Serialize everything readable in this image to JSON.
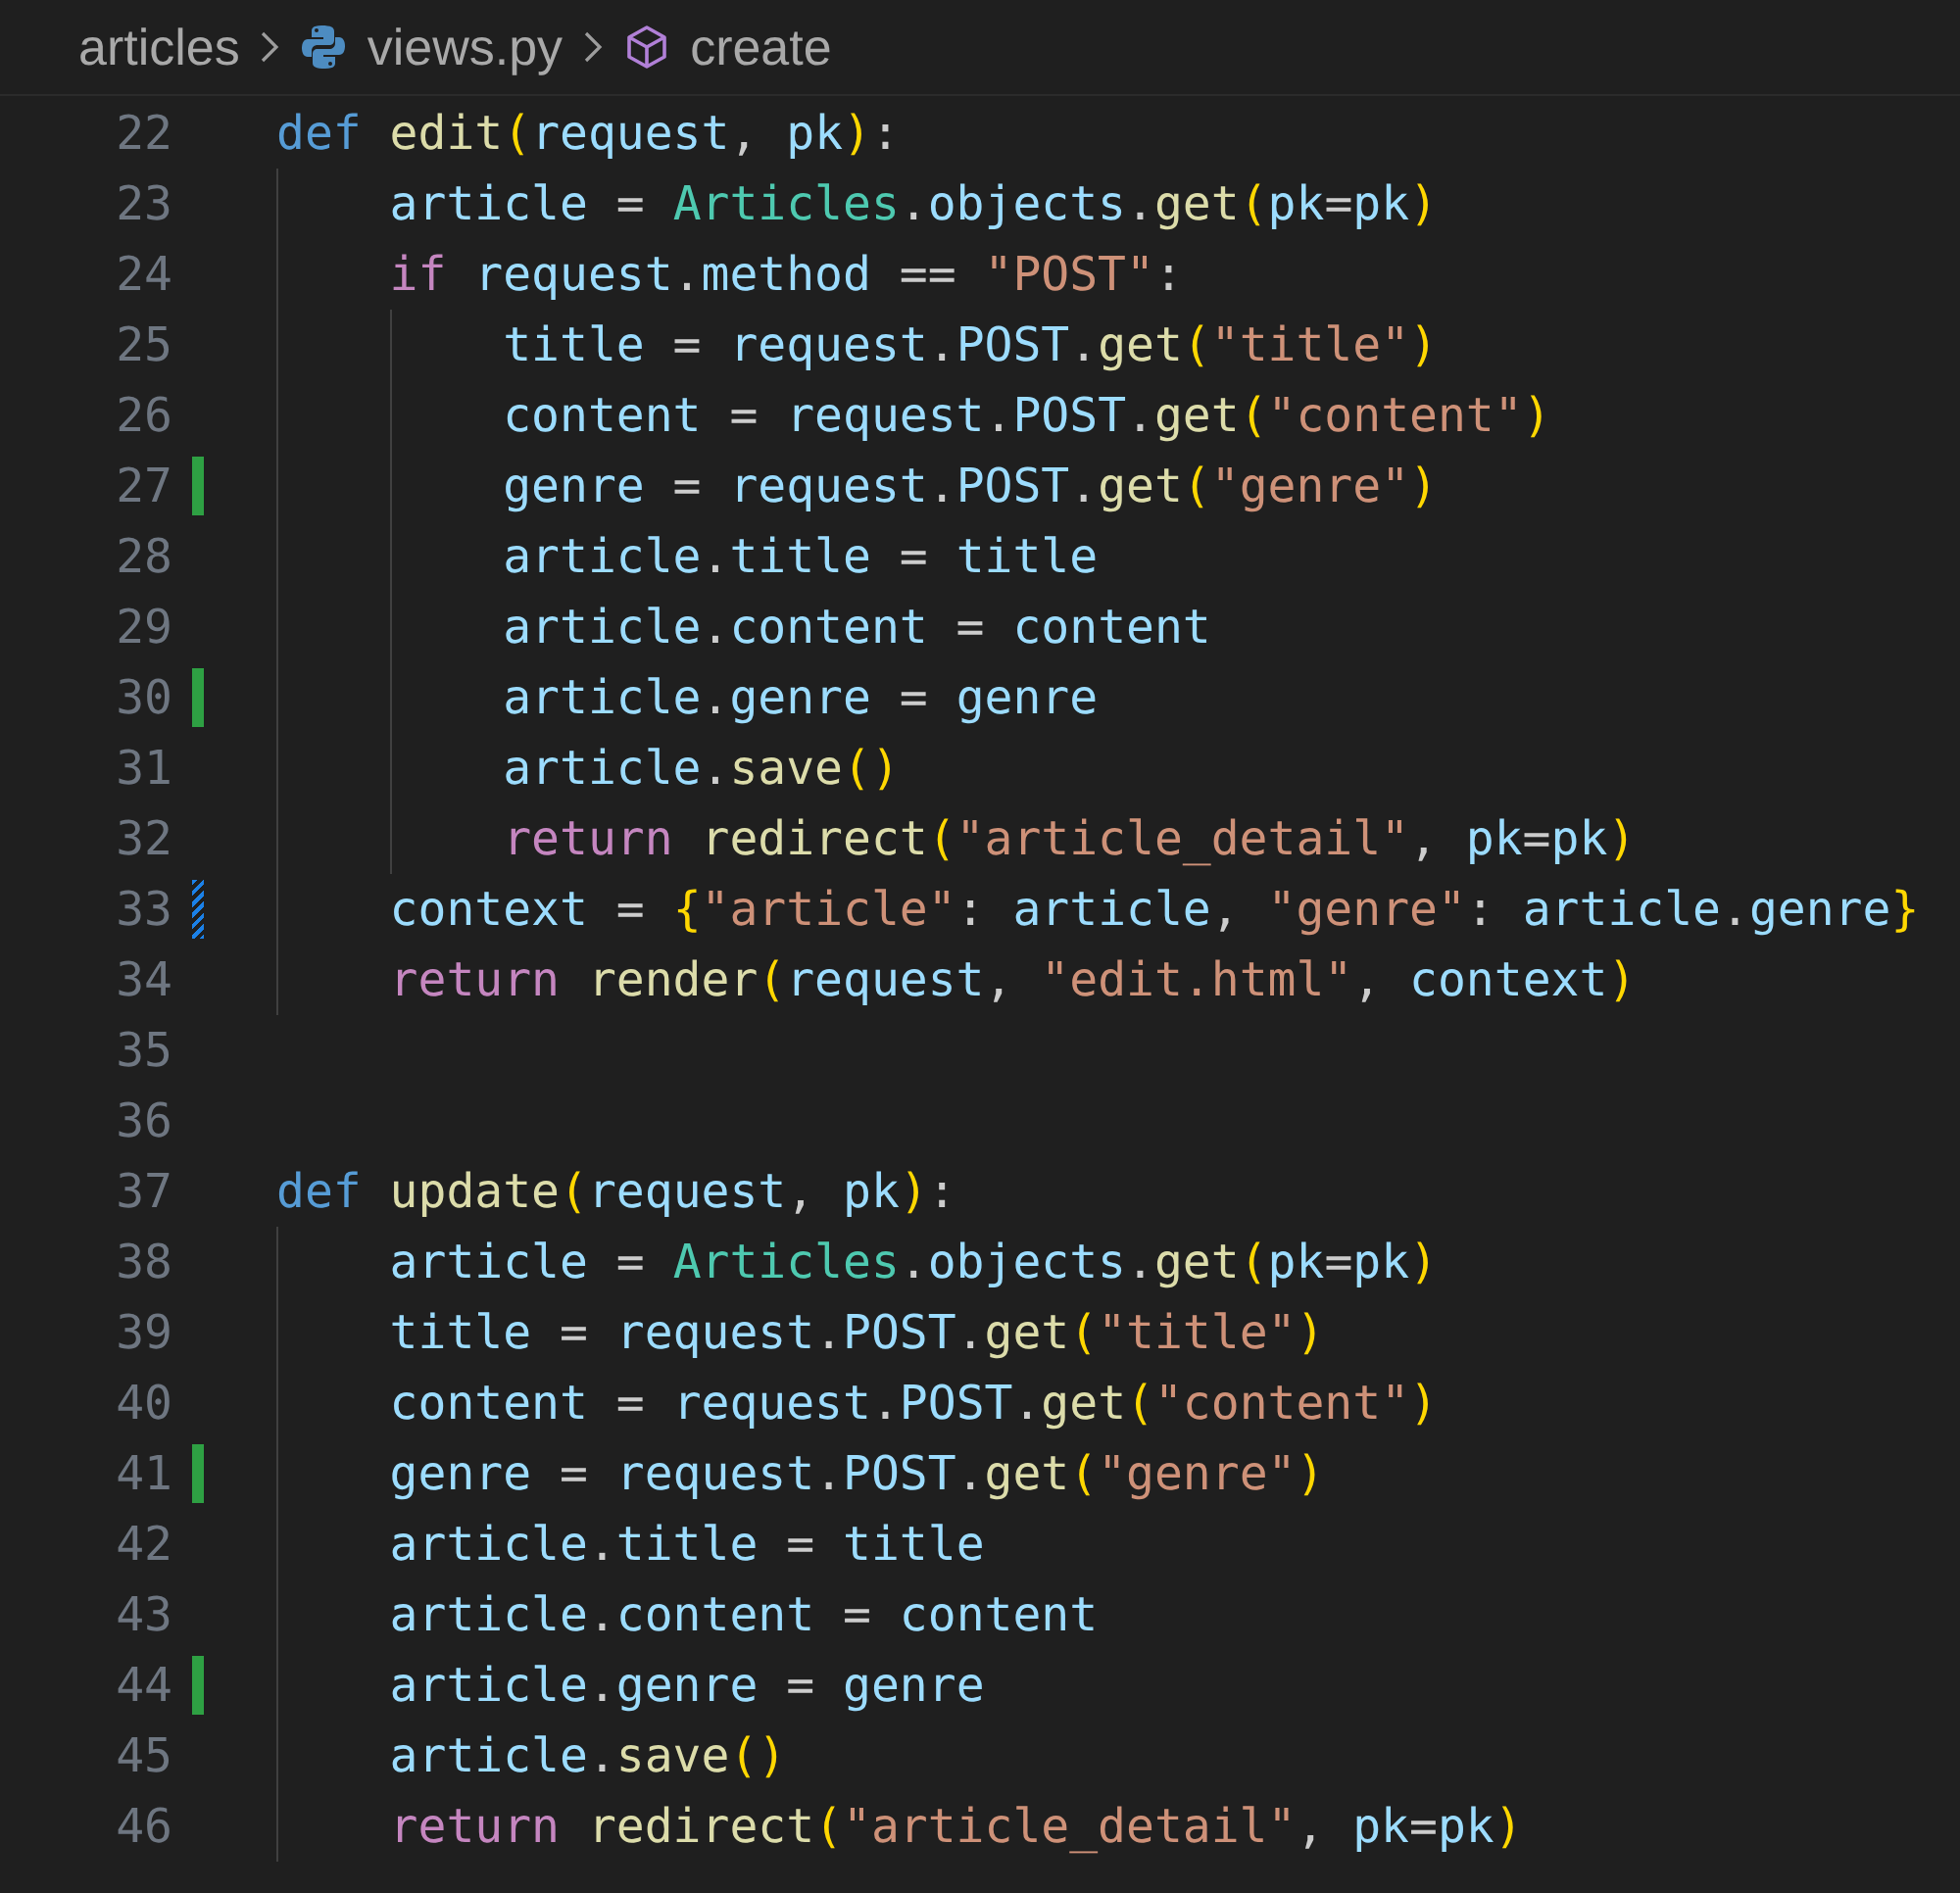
{
  "breadcrumb": [
    {
      "kind": "folder",
      "label": "articles"
    },
    {
      "kind": "python-file",
      "label": "views.py"
    },
    {
      "kind": "symbol",
      "label": "create"
    }
  ],
  "lines": [
    {
      "number": "22",
      "tokens": [
        {
          "kind": "kw",
          "text": "def"
        },
        {
          "kind": "fn",
          "text": " edit"
        },
        {
          "kind": "br",
          "text": "("
        },
        {
          "kind": "var",
          "text": "request"
        },
        {
          "kind": "p",
          "text": ", "
        },
        {
          "kind": "var",
          "text": "pk"
        },
        {
          "kind": "br",
          "text": ")"
        },
        {
          "kind": "p",
          "text": ":"
        }
      ],
      "children": [
        {
          "number": "23",
          "tokens": [
            {
              "kind": "var",
              "text": "article"
            },
            {
              "kind": "p",
              "text": " = "
            },
            {
              "kind": "cls",
              "text": "Articles"
            },
            {
              "kind": "p",
              "text": "."
            },
            {
              "kind": "var",
              "text": "objects"
            },
            {
              "kind": "p",
              "text": "."
            },
            {
              "kind": "fn",
              "text": "get"
            },
            {
              "kind": "br",
              "text": "("
            },
            {
              "kind": "var",
              "text": "pk"
            },
            {
              "kind": "p",
              "text": "="
            },
            {
              "kind": "var",
              "text": "pk"
            },
            {
              "kind": "br",
              "text": ")"
            }
          ]
        },
        {
          "number": "24",
          "tokens": [
            {
              "kind": "ctl",
              "text": "if"
            },
            {
              "kind": "var",
              "text": " request"
            },
            {
              "kind": "p",
              "text": "."
            },
            {
              "kind": "var",
              "text": "method"
            },
            {
              "kind": "p",
              "text": " == "
            },
            {
              "kind": "str",
              "text": "\"POST\""
            },
            {
              "kind": "p",
              "text": ":"
            }
          ],
          "children": [
            {
              "number": "25",
              "tokens": [
                {
                  "kind": "var",
                  "text": "title"
                },
                {
                  "kind": "p",
                  "text": " = "
                },
                {
                  "kind": "var",
                  "text": "request"
                },
                {
                  "kind": "p",
                  "text": "."
                },
                {
                  "kind": "var",
                  "text": "POST"
                },
                {
                  "kind": "p",
                  "text": "."
                },
                {
                  "kind": "fn",
                  "text": "get"
                },
                {
                  "kind": "br",
                  "text": "("
                },
                {
                  "kind": "str",
                  "text": "\"title\""
                },
                {
                  "kind": "br",
                  "text": ")"
                }
              ]
            },
            {
              "number": "26",
              "tokens": [
                {
                  "kind": "var",
                  "text": "content"
                },
                {
                  "kind": "p",
                  "text": " = "
                },
                {
                  "kind": "var",
                  "text": "request"
                },
                {
                  "kind": "p",
                  "text": "."
                },
                {
                  "kind": "var",
                  "text": "POST"
                },
                {
                  "kind": "p",
                  "text": "."
                },
                {
                  "kind": "fn",
                  "text": "get"
                },
                {
                  "kind": "br",
                  "text": "("
                },
                {
                  "kind": "str",
                  "text": "\"content\""
                },
                {
                  "kind": "br",
                  "text": ")"
                }
              ]
            },
            {
              "number": "27",
              "added": true,
              "tokens": [
                {
                  "kind": "var",
                  "text": "genre"
                },
                {
                  "kind": "p",
                  "text": " = "
                },
                {
                  "kind": "var",
                  "text": "request"
                },
                {
                  "kind": "p",
                  "text": "."
                },
                {
                  "kind": "var",
                  "text": "POST"
                },
                {
                  "kind": "p",
                  "text": "."
                },
                {
                  "kind": "fn",
                  "text": "get"
                },
                {
                  "kind": "br",
                  "text": "("
                },
                {
                  "kind": "str",
                  "text": "\"genre\""
                },
                {
                  "kind": "br",
                  "text": ")"
                }
              ]
            },
            {
              "number": "28",
              "tokens": [
                {
                  "kind": "var",
                  "text": "article"
                },
                {
                  "kind": "p",
                  "text": "."
                },
                {
                  "kind": "var",
                  "text": "title"
                },
                {
                  "kind": "p",
                  "text": " = "
                },
                {
                  "kind": "var",
                  "text": "title"
                }
              ]
            },
            {
              "number": "29",
              "tokens": [
                {
                  "kind": "var",
                  "text": "article"
                },
                {
                  "kind": "p",
                  "text": "."
                },
                {
                  "kind": "var",
                  "text": "content"
                },
                {
                  "kind": "p",
                  "text": " = "
                },
                {
                  "kind": "var",
                  "text": "content"
                }
              ]
            },
            {
              "number": "30",
              "added": true,
              "tokens": [
                {
                  "kind": "var",
                  "text": "article"
                },
                {
                  "kind": "p",
                  "text": "."
                },
                {
                  "kind": "var",
                  "text": "genre"
                },
                {
                  "kind": "p",
                  "text": " = "
                },
                {
                  "kind": "var",
                  "text": "genre"
                }
              ]
            },
            {
              "number": "31",
              "tokens": [
                {
                  "kind": "var",
                  "text": "article"
                },
                {
                  "kind": "p",
                  "text": "."
                },
                {
                  "kind": "fn",
                  "text": "save"
                },
                {
                  "kind": "br",
                  "text": "()"
                }
              ]
            },
            {
              "number": "32",
              "tokens": [
                {
                  "kind": "ctl",
                  "text": "return"
                },
                {
                  "kind": "fn",
                  "text": " redirect"
                },
                {
                  "kind": "br",
                  "text": "("
                },
                {
                  "kind": "str",
                  "text": "\"article_detail\""
                },
                {
                  "kind": "p",
                  "text": ", "
                },
                {
                  "kind": "var",
                  "text": "pk"
                },
                {
                  "kind": "p",
                  "text": "="
                },
                {
                  "kind": "var",
                  "text": "pk"
                },
                {
                  "kind": "br",
                  "text": ")"
                }
              ]
            }
          ]
        },
        {
          "number": "33",
          "modified": true,
          "tokens": [
            {
              "kind": "var",
              "text": "context"
            },
            {
              "kind": "p",
              "text": " = "
            },
            {
              "kind": "br",
              "text": "{"
            },
            {
              "kind": "str",
              "text": "\"article\""
            },
            {
              "kind": "p",
              "text": ": "
            },
            {
              "kind": "var",
              "text": "article"
            },
            {
              "kind": "p",
              "text": ", "
            },
            {
              "kind": "str",
              "text": "\"genre\""
            },
            {
              "kind": "p",
              "text": ": "
            },
            {
              "kind": "var",
              "text": "article"
            },
            {
              "kind": "p",
              "text": "."
            },
            {
              "kind": "var",
              "text": "genre"
            },
            {
              "kind": "br",
              "text": "}"
            }
          ]
        },
        {
          "number": "34",
          "tokens": [
            {
              "kind": "ctl",
              "text": "return"
            },
            {
              "kind": "fn",
              "text": " render"
            },
            {
              "kind": "br",
              "text": "("
            },
            {
              "kind": "var",
              "text": "request"
            },
            {
              "kind": "p",
              "text": ", "
            },
            {
              "kind": "str",
              "text": "\"edit.html\""
            },
            {
              "kind": "p",
              "text": ", "
            },
            {
              "kind": "var",
              "text": "context"
            },
            {
              "kind": "br",
              "text": ")"
            }
          ]
        }
      ]
    },
    {
      "number": "35"
    },
    {
      "number": "36"
    },
    {
      "number": "37",
      "tokens": [
        {
          "kind": "kw",
          "text": "def"
        },
        {
          "kind": "fn",
          "text": " update"
        },
        {
          "kind": "br",
          "text": "("
        },
        {
          "kind": "var",
          "text": "request"
        },
        {
          "kind": "p",
          "text": ", "
        },
        {
          "kind": "var",
          "text": "pk"
        },
        {
          "kind": "br",
          "text": ")"
        },
        {
          "kind": "p",
          "text": ":"
        }
      ],
      "children": [
        {
          "number": "38",
          "tokens": [
            {
              "kind": "var",
              "text": "article"
            },
            {
              "kind": "p",
              "text": " = "
            },
            {
              "kind": "cls",
              "text": "Articles"
            },
            {
              "kind": "p",
              "text": "."
            },
            {
              "kind": "var",
              "text": "objects"
            },
            {
              "kind": "p",
              "text": "."
            },
            {
              "kind": "fn",
              "text": "get"
            },
            {
              "kind": "br",
              "text": "("
            },
            {
              "kind": "var",
              "text": "pk"
            },
            {
              "kind": "p",
              "text": "="
            },
            {
              "kind": "var",
              "text": "pk"
            },
            {
              "kind": "br",
              "text": ")"
            }
          ]
        },
        {
          "number": "39",
          "tokens": [
            {
              "kind": "var",
              "text": "title"
            },
            {
              "kind": "p",
              "text": " = "
            },
            {
              "kind": "var",
              "text": "request"
            },
            {
              "kind": "p",
              "text": "."
            },
            {
              "kind": "var",
              "text": "POST"
            },
            {
              "kind": "p",
              "text": "."
            },
            {
              "kind": "fn",
              "text": "get"
            },
            {
              "kind": "br",
              "text": "("
            },
            {
              "kind": "str",
              "text": "\"title\""
            },
            {
              "kind": "br",
              "text": ")"
            }
          ]
        },
        {
          "number": "40",
          "tokens": [
            {
              "kind": "var",
              "text": "content"
            },
            {
              "kind": "p",
              "text": " = "
            },
            {
              "kind": "var",
              "text": "request"
            },
            {
              "kind": "p",
              "text": "."
            },
            {
              "kind": "var",
              "text": "POST"
            },
            {
              "kind": "p",
              "text": "."
            },
            {
              "kind": "fn",
              "text": "get"
            },
            {
              "kind": "br",
              "text": "("
            },
            {
              "kind": "str",
              "text": "\"content\""
            },
            {
              "kind": "br",
              "text": ")"
            }
          ]
        },
        {
          "number": "41",
          "added": true,
          "tokens": [
            {
              "kind": "var",
              "text": "genre"
            },
            {
              "kind": "p",
              "text": " = "
            },
            {
              "kind": "var",
              "text": "request"
            },
            {
              "kind": "p",
              "text": "."
            },
            {
              "kind": "var",
              "text": "POST"
            },
            {
              "kind": "p",
              "text": "."
            },
            {
              "kind": "fn",
              "text": "get"
            },
            {
              "kind": "br",
              "text": "("
            },
            {
              "kind": "str",
              "text": "\"genre\""
            },
            {
              "kind": "br",
              "text": ")"
            }
          ]
        },
        {
          "number": "42",
          "tokens": [
            {
              "kind": "var",
              "text": "article"
            },
            {
              "kind": "p",
              "text": "."
            },
            {
              "kind": "var",
              "text": "title"
            },
            {
              "kind": "p",
              "text": " = "
            },
            {
              "kind": "var",
              "text": "title"
            }
          ]
        },
        {
          "number": "43",
          "tokens": [
            {
              "kind": "var",
              "text": "article"
            },
            {
              "kind": "p",
              "text": "."
            },
            {
              "kind": "var",
              "text": "content"
            },
            {
              "kind": "p",
              "text": " = "
            },
            {
              "kind": "var",
              "text": "content"
            }
          ]
        },
        {
          "number": "44",
          "added": true,
          "tokens": [
            {
              "kind": "var",
              "text": "article"
            },
            {
              "kind": "p",
              "text": "."
            },
            {
              "kind": "var",
              "text": "genre"
            },
            {
              "kind": "p",
              "text": " = "
            },
            {
              "kind": "var",
              "text": "genre"
            }
          ]
        },
        {
          "number": "45",
          "tokens": [
            {
              "kind": "var",
              "text": "article"
            },
            {
              "kind": "p",
              "text": "."
            },
            {
              "kind": "fn",
              "text": "save"
            },
            {
              "kind": "br",
              "text": "()"
            }
          ]
        },
        {
          "number": "46",
          "tokens": [
            {
              "kind": "ctl",
              "text": "return"
            },
            {
              "kind": "fn",
              "text": " redirect"
            },
            {
              "kind": "br",
              "text": "("
            },
            {
              "kind": "str",
              "text": "\"article_detail\""
            },
            {
              "kind": "p",
              "text": ", "
            },
            {
              "kind": "var",
              "text": "pk"
            },
            {
              "kind": "p",
              "text": "="
            },
            {
              "kind": "var",
              "text": "pk"
            },
            {
              "kind": "br",
              "text": ")"
            }
          ]
        }
      ]
    }
  ]
}
